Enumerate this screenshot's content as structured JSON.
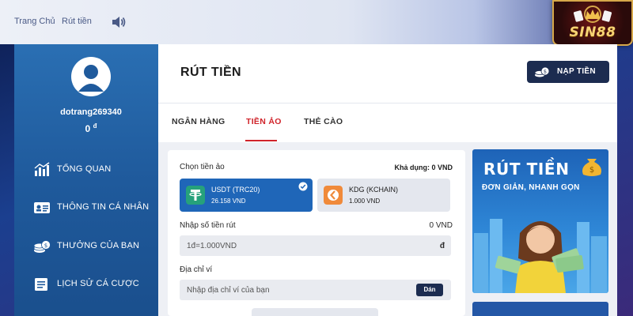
{
  "topbar": {
    "breadcrumb_home": "Trang Chủ",
    "breadcrumb_current": "Rút tiền",
    "logo_text": "SIN88"
  },
  "sidebar": {
    "username": "dotrang269340",
    "balance": "0",
    "currency_symbol": "đ",
    "items": [
      {
        "label": "TỔNG QUAN",
        "icon": "chart-icon"
      },
      {
        "label": "THÔNG TIN CÁ NHÂN",
        "icon": "profile-card-icon"
      },
      {
        "label": "THƯỞNG CỦA BẠN",
        "icon": "coins-icon"
      },
      {
        "label": "LỊCH SỬ CÁ CƯỢC",
        "icon": "history-icon"
      }
    ]
  },
  "main": {
    "title": "RÚT TIỀN",
    "deposit_button": "NẠP TIỀN",
    "tabs": [
      {
        "label": "NGÂN HÀNG",
        "active": false
      },
      {
        "label": "TIỀN ẢO",
        "active": true
      },
      {
        "label": "THẺ CÀO",
        "active": false
      }
    ]
  },
  "form": {
    "choose_coin_label": "Chọn tiền ảo",
    "available": "Khả dụng: 0 VND",
    "coins": [
      {
        "name": "USDT (TRC20)",
        "rate": "26.158 VND",
        "selected": true,
        "icon": "tether-icon"
      },
      {
        "name": "KDG (KCHAIN)",
        "rate": "1.000 VND",
        "selected": false,
        "icon": "kchain-icon"
      }
    ],
    "amount_label": "Nhập số tiền rút",
    "amount_value": "0 VND",
    "amount_placeholder": "1đ=1.000VND",
    "amount_unit": "đ",
    "address_label": "Địa chỉ ví",
    "address_placeholder": "Nhập địa chỉ ví của bạn",
    "paste_button": "Dán"
  },
  "promo": {
    "title": "RÚT TIỀN",
    "subtitle": "ĐƠN GIẢN, NHANH GỌN"
  },
  "colors": {
    "accent_red": "#d0242b",
    "navy": "#1c2c50",
    "sidebar_blue": "#1f5a9c",
    "selected_coin": "#1f66b8"
  }
}
